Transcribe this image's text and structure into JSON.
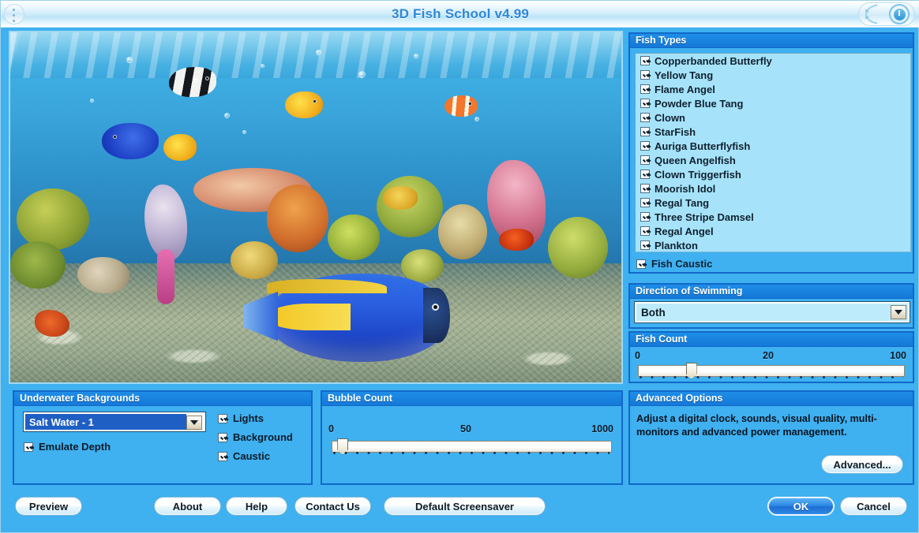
{
  "window": {
    "title": "3D Fish School v4.99",
    "power_icon": "power-waves-icon"
  },
  "preview": {
    "name": "aquarium-preview",
    "scene": "Underwater coral reef with tropical fish, light rays and bubbles"
  },
  "fish_types": {
    "header": "Fish Types",
    "items": [
      {
        "label": "Copperbanded Butterfly",
        "checked": true
      },
      {
        "label": "Yellow Tang",
        "checked": true
      },
      {
        "label": "Flame Angel",
        "checked": true
      },
      {
        "label": "Powder Blue Tang",
        "checked": true
      },
      {
        "label": "Clown",
        "checked": true
      },
      {
        "label": "StarFish",
        "checked": true
      },
      {
        "label": "Auriga Butterflyfish",
        "checked": true
      },
      {
        "label": "Queen Angelfish",
        "checked": true
      },
      {
        "label": "Clown Triggerfish",
        "checked": true
      },
      {
        "label": "Moorish Idol",
        "checked": true
      },
      {
        "label": "Regal Tang",
        "checked": true
      },
      {
        "label": "Three Stripe Damsel",
        "checked": true
      },
      {
        "label": "Regal Angel",
        "checked": true
      },
      {
        "label": "Plankton",
        "checked": true
      }
    ],
    "fish_caustic": {
      "label": "Fish Caustic",
      "checked": true
    }
  },
  "direction": {
    "header": "Direction of Swimming",
    "value": "Both"
  },
  "fish_count": {
    "header": "Fish Count",
    "min_label": "0",
    "mid_label": "20",
    "max_label": "100",
    "value_percent": 20
  },
  "advanced": {
    "header": "Advanced Options",
    "description": "Adjust a digital clock, sounds, visual quality, multi-monitors and advanced power management.",
    "button_label": "Advanced..."
  },
  "backgrounds": {
    "header": "Underwater Backgrounds",
    "selected": "Salt Water - 1",
    "emulate_depth": {
      "label": "Emulate Depth",
      "checked": true
    },
    "options": [
      {
        "label": "Lights",
        "checked": true
      },
      {
        "label": "Background",
        "checked": true
      },
      {
        "label": "Caustic",
        "checked": true
      }
    ]
  },
  "bubble_count": {
    "header": "Bubble Count",
    "min_label": "0",
    "mid_label": "50",
    "max_label": "1000",
    "value_percent": 4
  },
  "buttons": {
    "preview": "Preview",
    "about": "About",
    "help": "Help",
    "contact": "Contact Us",
    "default_screensaver": "Default Screensaver",
    "ok": "OK",
    "cancel": "Cancel"
  },
  "colors": {
    "window_blue": "#3FB0F0",
    "header_blue": "#1478D8",
    "list_bg": "#A6E3FA",
    "panel_border": "#1169C8",
    "title_text": "#2E86D8",
    "selection_blue": "#1F5FC4"
  }
}
